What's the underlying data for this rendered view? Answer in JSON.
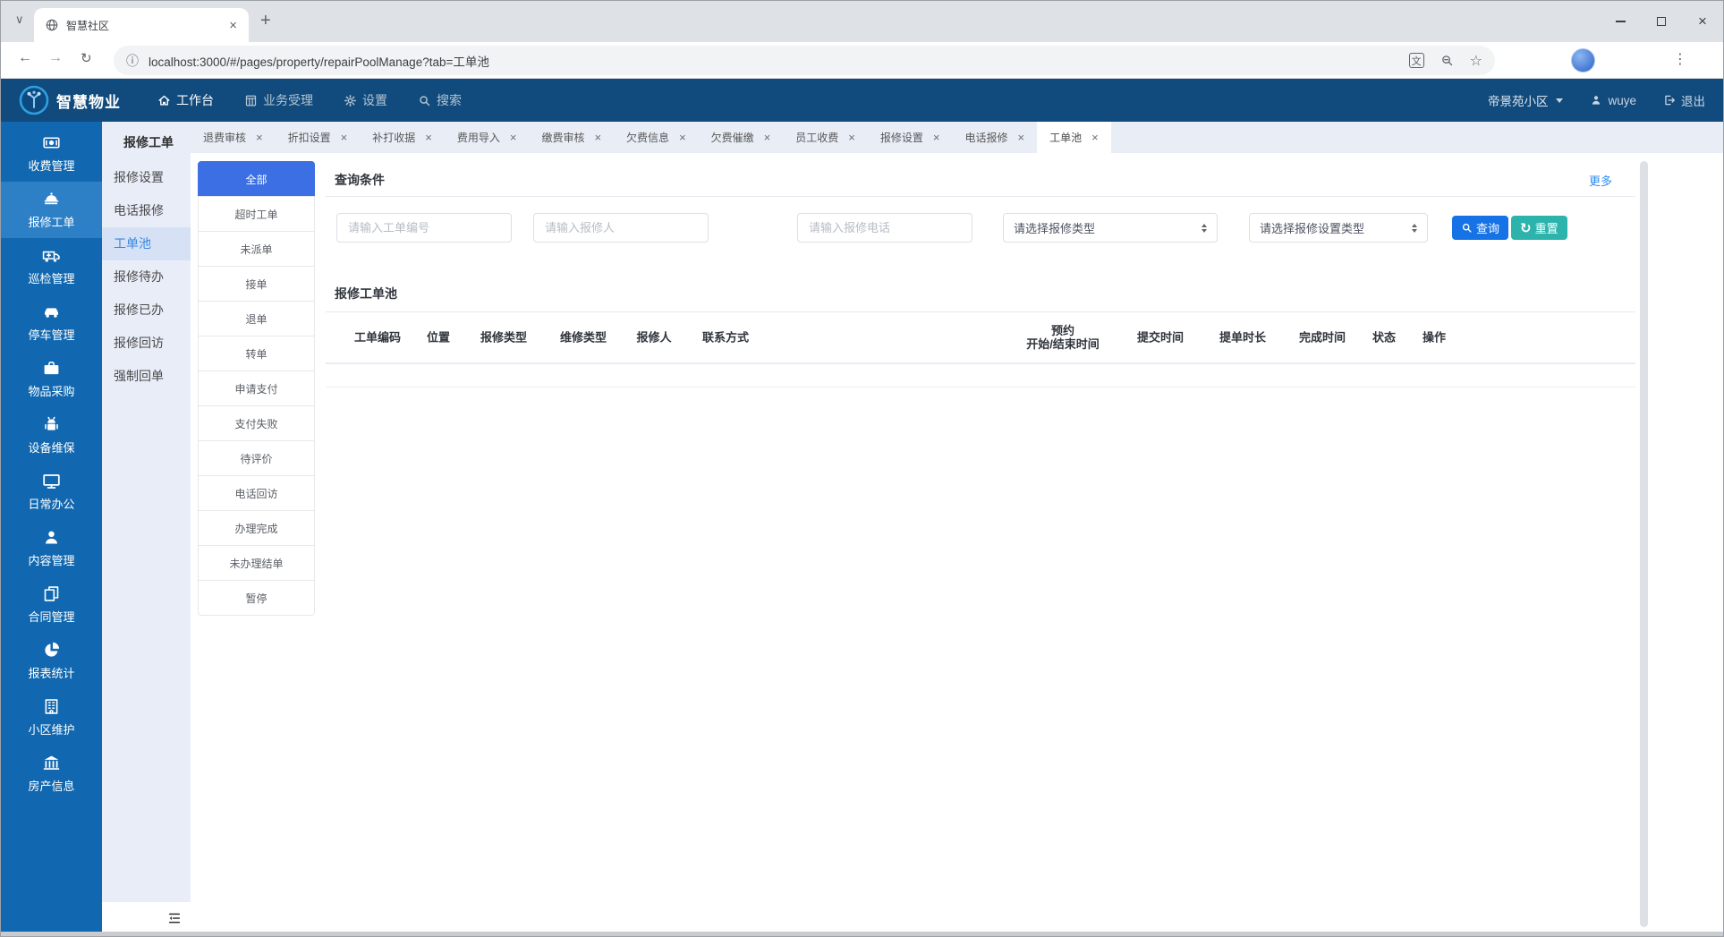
{
  "browser": {
    "tab_title": "智慧社区",
    "url": "localhost:3000/#/pages/property/repairPoolManage?tab=工单池"
  },
  "navbar": {
    "brand": "智慧物业",
    "menu": [
      {
        "label": "工作台",
        "icon": "home-icon",
        "active": true
      },
      {
        "label": "业务受理",
        "icon": "abacus-icon",
        "active": false
      },
      {
        "label": "设置",
        "icon": "gear-icon",
        "active": false
      },
      {
        "label": "搜索",
        "icon": "search-icon",
        "active": false
      }
    ],
    "community": "帝景苑小区",
    "username": "wuye",
    "logout_label": "退出"
  },
  "sidebar": {
    "items": [
      {
        "label": "收费管理",
        "icon": "banknote-icon",
        "active": false
      },
      {
        "label": "报修工单",
        "icon": "repair-bell-icon",
        "active": true
      },
      {
        "label": "巡检管理",
        "icon": "patrol-truck-icon",
        "active": false
      },
      {
        "label": "停车管理",
        "icon": "car-icon",
        "active": false
      },
      {
        "label": "物品采购",
        "icon": "briefcase-icon",
        "active": false
      },
      {
        "label": "设备维保",
        "icon": "robot-icon",
        "active": false
      },
      {
        "label": "日常办公",
        "icon": "desktop-icon",
        "active": false
      },
      {
        "label": "内容管理",
        "icon": "user-icon",
        "active": false
      },
      {
        "label": "合同管理",
        "icon": "documents-icon",
        "active": false
      },
      {
        "label": "报表统计",
        "icon": "pie-chart-icon",
        "active": false
      },
      {
        "label": "小区维护",
        "icon": "building-icon",
        "active": false
      },
      {
        "label": "房产信息",
        "icon": "bank-icon",
        "active": false
      }
    ]
  },
  "submenu": {
    "title": "报修工单",
    "items": [
      {
        "label": "报修设置",
        "active": false
      },
      {
        "label": "电话报修",
        "active": false
      },
      {
        "label": "工单池",
        "active": true
      },
      {
        "label": "报修待办",
        "active": false
      },
      {
        "label": "报修已办",
        "active": false
      },
      {
        "label": "报修回访",
        "active": false
      },
      {
        "label": "强制回单",
        "active": false
      }
    ]
  },
  "tabbar": {
    "tabs": [
      {
        "label": "退费审核",
        "active": false
      },
      {
        "label": "折扣设置",
        "active": false
      },
      {
        "label": "补打收据",
        "active": false
      },
      {
        "label": "费用导入",
        "active": false
      },
      {
        "label": "缴费审核",
        "active": false
      },
      {
        "label": "欠费信息",
        "active": false
      },
      {
        "label": "欠费催缴",
        "active": false
      },
      {
        "label": "员工收费",
        "active": false
      },
      {
        "label": "报修设置",
        "active": false
      },
      {
        "label": "电话报修",
        "active": false
      },
      {
        "label": "工单池",
        "active": true
      }
    ]
  },
  "filters": {
    "items": [
      {
        "label": "全部",
        "active": true
      },
      {
        "label": "超时工单",
        "active": false
      },
      {
        "label": "未派单",
        "active": false
      },
      {
        "label": "接单",
        "active": false
      },
      {
        "label": "退单",
        "active": false
      },
      {
        "label": "转单",
        "active": false
      },
      {
        "label": "申请支付",
        "active": false
      },
      {
        "label": "支付失败",
        "active": false
      },
      {
        "label": "待评价",
        "active": false
      },
      {
        "label": "电话回访",
        "active": false
      },
      {
        "label": "办理完成",
        "active": false
      },
      {
        "label": "未办理结单",
        "active": false
      },
      {
        "label": "暂停",
        "active": false
      }
    ]
  },
  "query": {
    "title": "查询条件",
    "more_label": "更多",
    "order_no_placeholder": "请输入工单编号",
    "reporter_placeholder": "请输入报修人",
    "phone_placeholder": "请输入报修电话",
    "repair_type_placeholder": "请选择报修类型",
    "repair_setting_type_placeholder": "请选择报修设置类型",
    "search_label": "查询",
    "reset_label": "重置"
  },
  "pool": {
    "title": "报修工单池",
    "columns": [
      "工单编码",
      "位置",
      "报修类型",
      "维修类型",
      "报修人",
      "联系方式",
      "预约\n开始/结束时间",
      "提交时间",
      "提单时长",
      "完成时间",
      "状态",
      "操作"
    ],
    "rows": []
  },
  "colors": {
    "navbar": "#114a7c",
    "sidebar": "#1268b0",
    "sidebar_active": "#2e80c6",
    "accent_blue": "#1573e6",
    "teal": "#2cb4ac",
    "filter_active": "#3b6fe3",
    "link": "#2d8cf0"
  }
}
